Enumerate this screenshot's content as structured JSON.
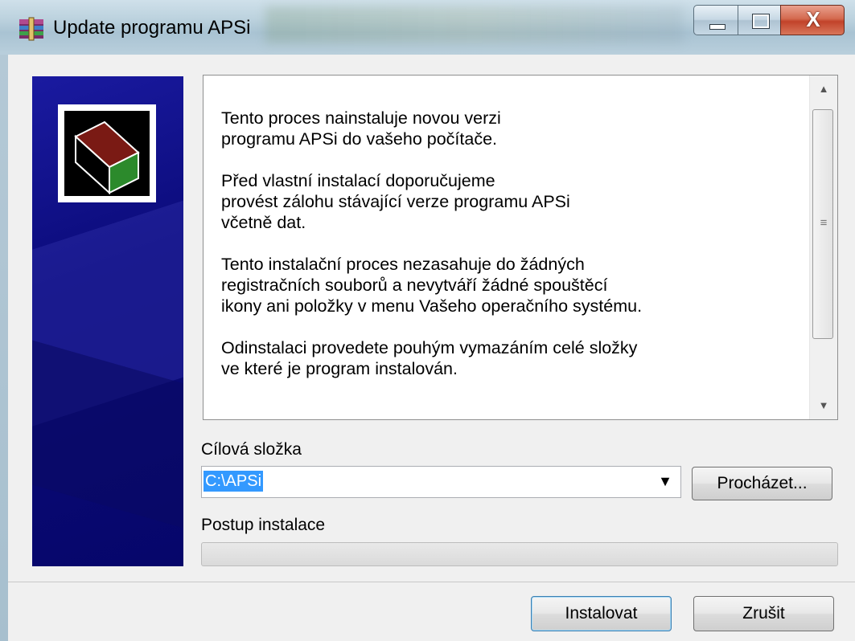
{
  "window": {
    "title": "Update programu APSi",
    "controls": {
      "minimize_icon": "minimize-icon",
      "maximize_icon": "maximize-icon",
      "close_label": "X"
    }
  },
  "info": {
    "paragraphs": [
      "Tento proces nainstaluje novou verzi\nprogramu APSi do vašeho počítače.",
      "Před vlastní instalací doporučujeme\nprovést zálohu stávající verze programu APSi\nvčetně dat.",
      "Tento instalační proces nezasahuje do žádných\nregistračních souborů a nevytváří žádné spouštěcí\nikony ani položky v menu Vašeho operačního systému.",
      "Odinstalaci provedete pouhým vymazáním celé složky\nve které je program instalován."
    ]
  },
  "target": {
    "label": "Cílová složka",
    "value": "C:\\APSi",
    "browse_label": "Procházet..."
  },
  "progress": {
    "label": "Postup instalace",
    "value": 0
  },
  "buttons": {
    "install_label": "Instalovat",
    "cancel_label": "Zrušit"
  },
  "colors": {
    "banner": "#0b0b7a",
    "selection": "#3399ff",
    "close_button": "#c2432a"
  }
}
